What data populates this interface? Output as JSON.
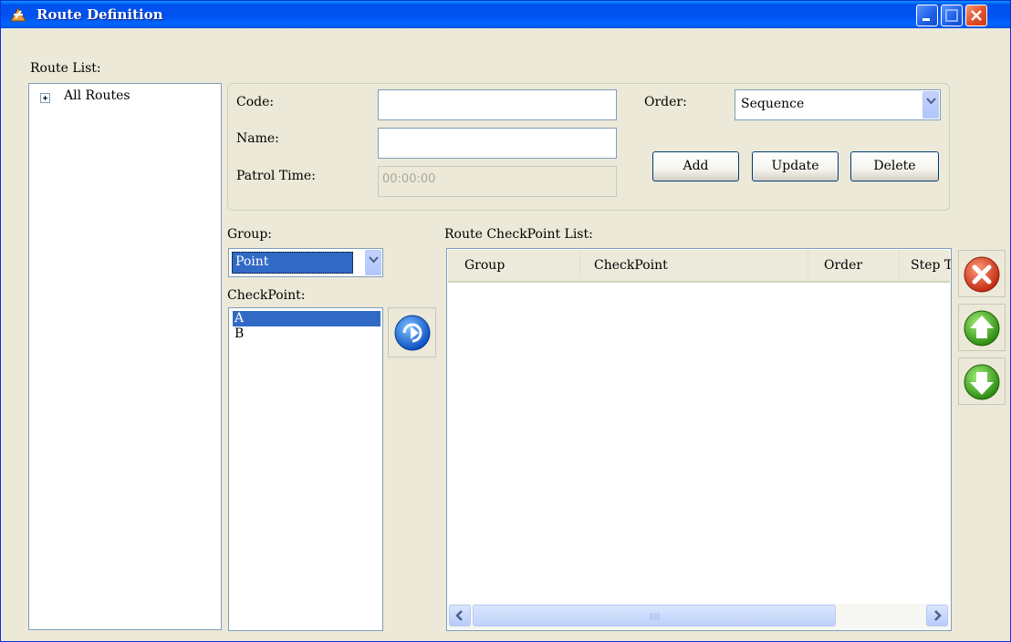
{
  "window": {
    "title": "Route Definition",
    "icon": "route-app-icon",
    "controls": [
      "minimize-icon",
      "maximize-icon",
      "close-icon"
    ]
  },
  "route_list": {
    "label": "Route List:",
    "tree_root": "All Routes",
    "expander_icon": "plus-box-icon"
  },
  "form": {
    "code_label": "Code:",
    "code_value": "",
    "name_label": "Name:",
    "name_value": "",
    "patrol_time_label": "Patrol Time:",
    "patrol_time_value": "00:00:00",
    "order_label": "Order:",
    "order_value": "Sequence",
    "add_label": "Add",
    "update_label": "Update",
    "delete_label": "Delete"
  },
  "group": {
    "label": "Group:",
    "value": "Point"
  },
  "checkpoint": {
    "label": "CheckPoint:",
    "items": [
      "A",
      "B"
    ],
    "selected": "A"
  },
  "route_checkpoints": {
    "label": "Route CheckPoint List:",
    "columns": [
      "Group",
      "CheckPoint",
      "Order",
      "Step Time"
    ],
    "rows": []
  },
  "icons": {
    "add_arrow": "blue-arrow-right-icon",
    "remove": "red-x-circle-icon",
    "move_up": "green-up-arrow-icon",
    "move_down": "green-down-arrow-icon"
  },
  "colors": {
    "titlebar": "#0054e3",
    "window_bg": "#ece9d8",
    "selection": "#316ac5",
    "close_button": "#e3532b",
    "remove_icon": "#e2402a",
    "move_icon": "#3aa81c"
  }
}
